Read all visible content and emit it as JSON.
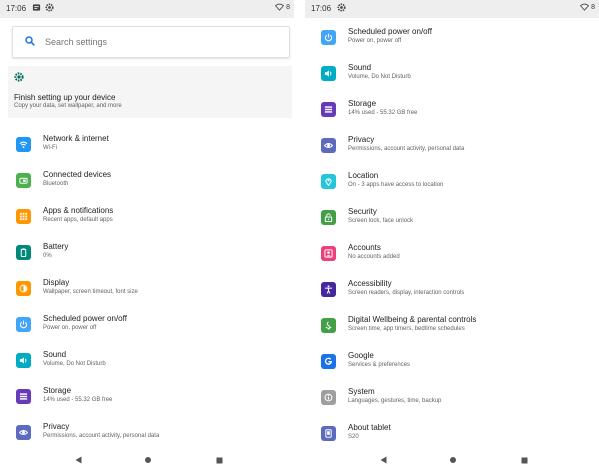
{
  "status": {
    "time": "17:06",
    "battery": "8"
  },
  "search": {
    "placeholder": "Search settings"
  },
  "suggestion": {
    "title": "Finish setting up your device",
    "subtitle": "Copy your data, set wallpaper, and more"
  },
  "colors": {
    "network": "#2196F3",
    "connected": "#4CAF50",
    "apps": "#FF9800",
    "battery": "#00897B",
    "display": "#FF9800",
    "power": "#42A5F5",
    "sound": "#00ACC1",
    "storage": "#673AB7",
    "privacy": "#5C6BC0",
    "location": "#26C6DA",
    "security": "#43A047",
    "accounts": "#EC407A",
    "accessibility": "#4527A0",
    "wellbeing": "#43A047",
    "google": "#1A73E8",
    "system": "#9E9E9E",
    "about": "#5C6BC0"
  },
  "left_items": [
    {
      "icon": "wifi-icon",
      "title": "Network & internet",
      "subtitle": "Wi-Fi"
    },
    {
      "icon": "connected-devices-icon",
      "title": "Connected devices",
      "subtitle": "Bluetooth"
    },
    {
      "icon": "apps-grid-icon",
      "title": "Apps & notifications",
      "subtitle": "Recent apps, default apps"
    },
    {
      "icon": "battery-icon",
      "title": "Battery",
      "subtitle": "0%"
    },
    {
      "icon": "brightness-icon",
      "title": "Display",
      "subtitle": "Wallpaper, screen timeout, font size"
    },
    {
      "icon": "power-icon",
      "title": "Scheduled power on/off",
      "subtitle": "Power on, power off"
    },
    {
      "icon": "volume-icon",
      "title": "Sound",
      "subtitle": "Volume, Do Not Disturb"
    },
    {
      "icon": "storage-icon",
      "title": "Storage",
      "subtitle": "14% used - 55.32 GB free"
    },
    {
      "icon": "privacy-icon",
      "title": "Privacy",
      "subtitle": "Permissions, account activity, personal data"
    }
  ],
  "right_items": [
    {
      "icon": "power-icon",
      "title": "Scheduled power on/off",
      "subtitle": "Power on, power off"
    },
    {
      "icon": "volume-icon",
      "title": "Sound",
      "subtitle": "Volume, Do Not Disturb"
    },
    {
      "icon": "storage-icon",
      "title": "Storage",
      "subtitle": "14% used - 55.32 GB free"
    },
    {
      "icon": "privacy-icon",
      "title": "Privacy",
      "subtitle": "Permissions, account activity, personal data"
    },
    {
      "icon": "location-pin-icon",
      "title": "Location",
      "subtitle": "On - 3 apps have access to location"
    },
    {
      "icon": "lock-icon",
      "title": "Security",
      "subtitle": "Screen lock, face unlock"
    },
    {
      "icon": "account-icon",
      "title": "Accounts",
      "subtitle": "No accounts added"
    },
    {
      "icon": "accessibility-icon",
      "title": "Accessibility",
      "subtitle": "Screen readers, display, interaction controls"
    },
    {
      "icon": "wellbeing-icon",
      "title": "Digital Wellbeing & parental controls",
      "subtitle": "Screen time, app timers, bedtime schedules"
    },
    {
      "icon": "google-icon",
      "title": "Google",
      "subtitle": "Services & preferences"
    },
    {
      "icon": "system-info-icon",
      "title": "System",
      "subtitle": "Languages, gestures, time, backup"
    },
    {
      "icon": "tablet-icon",
      "title": "About tablet",
      "subtitle": "S20"
    }
  ]
}
